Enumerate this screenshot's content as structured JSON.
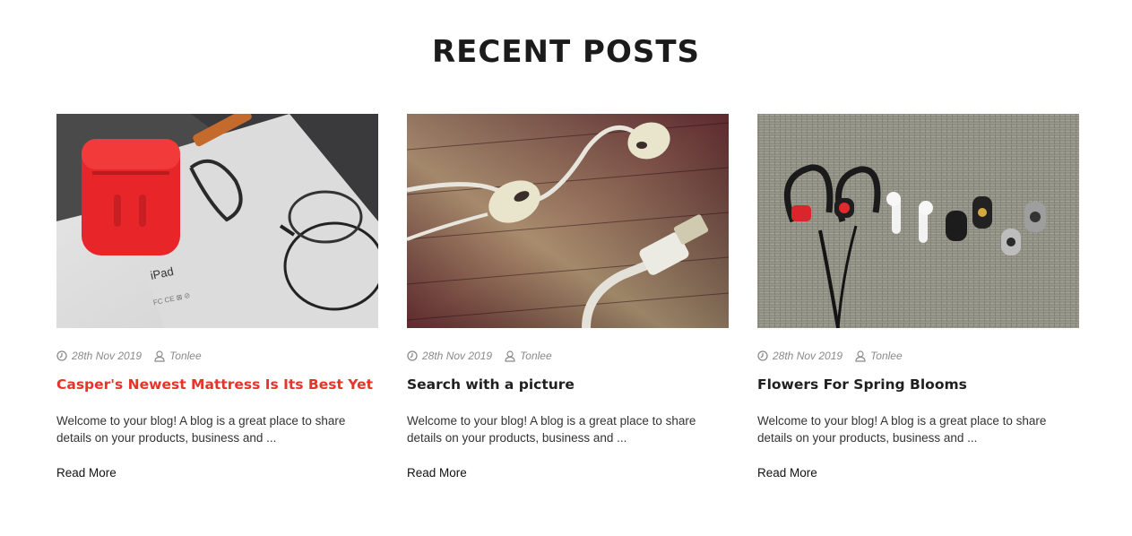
{
  "section": {
    "title": "RECENT POSTS"
  },
  "posts": [
    {
      "date": "28th Nov 2019",
      "author": "Tonlee",
      "title": "Casper's Newest Mattress Is Its Best Yet",
      "excerpt": "Welcome to your blog! A blog is a great place to share details on your products, business and ...",
      "read_more": "Read More",
      "image_text": "iPad"
    },
    {
      "date": "28th Nov 2019",
      "author": "Tonlee",
      "title": "Search with a picture",
      "excerpt": "Welcome to your blog! A blog is a great place to share details on your products, business and ...",
      "read_more": "Read More"
    },
    {
      "date": "28th Nov 2019",
      "author": "Tonlee",
      "title": "Flowers For Spring Blooms",
      "excerpt": "Welcome to your blog! A blog is a great place to share details on your products, business and ...",
      "read_more": "Read More"
    }
  ],
  "colors": {
    "accent": "#e8332b",
    "meta_text": "#8a8a8a",
    "heading": "#1b1b1b"
  },
  "icons": {
    "date": "clock-icon",
    "author": "user-icon"
  }
}
